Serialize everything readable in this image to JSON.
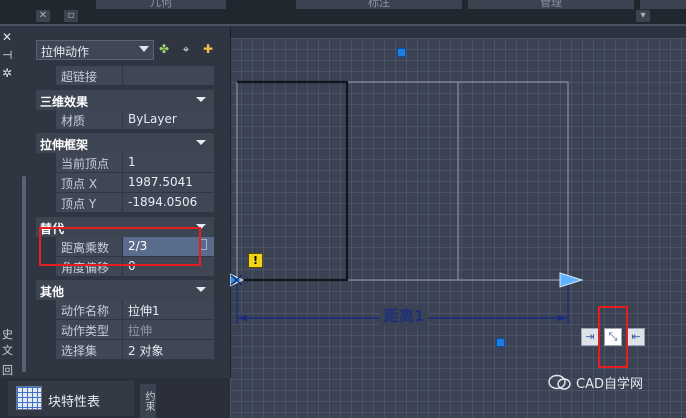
{
  "ribbon": {
    "tabs": [
      "几何",
      "标注",
      "管理"
    ],
    "collapse_icon": "close-x-icon"
  },
  "left_strip": {
    "top_icons": [
      "close-x-icon",
      "gear-icon"
    ],
    "side_glyphs": [
      "史",
      "文",
      "回"
    ]
  },
  "palette": {
    "object_type": "拉伸动作",
    "toolbar_icons": [
      "quick-select-icon",
      "pick-point-icon",
      "toggle-pickadd-icon"
    ],
    "hyperlink_row": {
      "key": "超链接",
      "value": ""
    },
    "sections": [
      {
        "title": "三维效果",
        "rows": [
          {
            "key": "材质",
            "value": "ByLayer"
          }
        ]
      },
      {
        "title": "拉伸框架",
        "rows": [
          {
            "key": "当前顶点",
            "value": "1"
          },
          {
            "key": "顶点 X",
            "value": "1987.5041"
          },
          {
            "key": "顶点 Y",
            "value": "-1894.0506"
          }
        ]
      },
      {
        "title": "替代",
        "rows": [
          {
            "key": "距离乘数",
            "value": "2/3"
          },
          {
            "key": "角度偏移",
            "value": "0"
          }
        ]
      },
      {
        "title": "其他",
        "rows": [
          {
            "key": "动作名称",
            "value": "拉伸1"
          },
          {
            "key": "动作类型",
            "value": "拉伸"
          },
          {
            "key": "选择集",
            "value": "2 对象"
          }
        ]
      }
    ]
  },
  "bottom_tabs": {
    "block_properties": "块特性表",
    "vertical_tab": "约束"
  },
  "drawing": {
    "dimension_label": "距离1",
    "warning_glyph": "!",
    "pin_icons": [
      "action-bar-icon-1",
      "action-bar-icon-2",
      "action-bar-icon-3"
    ],
    "line_color": "#1a2a80",
    "grip_color": "#1e7de0"
  },
  "watermark": "CAD自学网"
}
